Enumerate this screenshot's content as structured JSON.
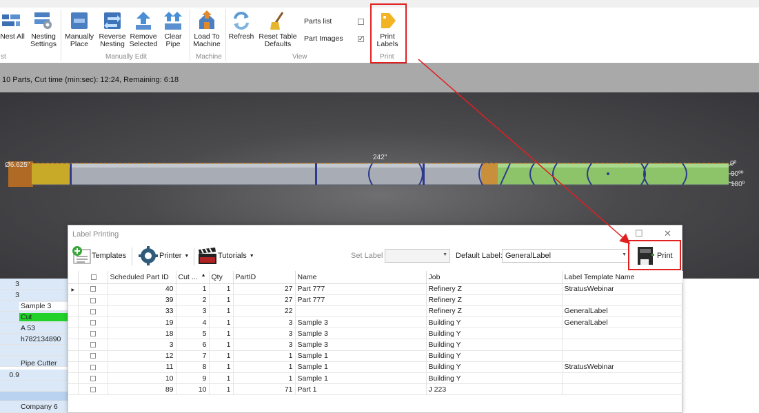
{
  "ribbon": {
    "buttons": [
      {
        "label": "Nest All",
        "icon": "nest-all-icon"
      },
      {
        "label": "Nesting\nSettings",
        "icon": "nesting-settings-icon"
      },
      {
        "label": "Manually\nPlace",
        "icon": "manually-place-icon"
      },
      {
        "label": "Reverse\nNesting",
        "icon": "reverse-nesting-icon"
      },
      {
        "label": "Remove\nSelected",
        "icon": "remove-selected-icon"
      },
      {
        "label": "Clear\nPipe",
        "icon": "clear-pipe-icon"
      },
      {
        "label": "Load To\nMachine",
        "icon": "load-to-machine-icon"
      },
      {
        "label": "Refresh",
        "icon": "refresh-icon"
      },
      {
        "label": "Reset Table\nDefaults",
        "icon": "reset-table-icon"
      },
      {
        "label": "Print\nLabels",
        "icon": "print-labels-icon"
      }
    ],
    "groups": {
      "nest": "st",
      "manual_edit": "Manually Edit",
      "machine": "Machine",
      "view": "View",
      "print": "Print"
    },
    "view_checks": [
      {
        "label": "Parts list",
        "checked": false
      },
      {
        "label": "Part Images",
        "checked": true
      }
    ]
  },
  "status": {
    "text": "10 Parts,   Cut time (min:sec): 12:24, Remaining: 6:18"
  },
  "viewport": {
    "diameter": "Ø6.625\"",
    "length": "242\"",
    "angle_0": "0º",
    "angle_90": "90ºº",
    "angle_180": "180º"
  },
  "left_grid": {
    "rows": [
      {
        "num": "3",
        "text": ""
      },
      {
        "num": "3",
        "text": ""
      },
      {
        "num": "",
        "text": "Sample 3"
      },
      {
        "num": "",
        "text": "Cut"
      },
      {
        "num": "",
        "text": "A 53"
      },
      {
        "num": "",
        "text": "h782134890"
      },
      {
        "num": "",
        "text": ""
      },
      {
        "num": "",
        "text": "Pipe Cutter"
      },
      {
        "num": "0.9",
        "text": ""
      },
      {
        "num": "",
        "text": ""
      },
      {
        "num": "",
        "text": ""
      },
      {
        "num": "",
        "text": "Company 6"
      }
    ]
  },
  "dialog": {
    "title": "Label Printing",
    "toolbar": {
      "templates": "Templates",
      "printer": "Printer",
      "tutorials": "Tutorials",
      "set_label": "Set Label",
      "set_label_value": "",
      "default_label": "Default Label:",
      "default_label_value": "GeneralLabel",
      "print": "Print"
    },
    "columns": [
      "",
      "",
      "Scheduled Part ID",
      "Cut ...",
      "Qty",
      "PartID",
      "Name",
      "Job",
      "Label Template Name"
    ],
    "rows": [
      {
        "spid": "40",
        "cut": "1",
        "qty": "1",
        "partid": "27",
        "name": "Part 777",
        "job": "Refinery Z",
        "template": "StratusWebinar"
      },
      {
        "spid": "39",
        "cut": "2",
        "qty": "1",
        "partid": "27",
        "name": "Part 777",
        "job": "Refinery Z",
        "template": ""
      },
      {
        "spid": "33",
        "cut": "3",
        "qty": "1",
        "partid": "22",
        "name": "",
        "job": "Refinery Z",
        "template": "GeneralLabel"
      },
      {
        "spid": "19",
        "cut": "4",
        "qty": "1",
        "partid": "3",
        "name": "Sample 3",
        "job": "Building Y",
        "template": "GeneralLabel"
      },
      {
        "spid": "18",
        "cut": "5",
        "qty": "1",
        "partid": "3",
        "name": "Sample 3",
        "job": "Building Y",
        "template": ""
      },
      {
        "spid": "3",
        "cut": "6",
        "qty": "1",
        "partid": "3",
        "name": "Sample 3",
        "job": "Building Y",
        "template": ""
      },
      {
        "spid": "12",
        "cut": "7",
        "qty": "1",
        "partid": "1",
        "name": "Sample 1",
        "job": "Building Y",
        "template": ""
      },
      {
        "spid": "11",
        "cut": "8",
        "qty": "1",
        "partid": "1",
        "name": "Sample 1",
        "job": "Building Y",
        "template": "StratusWebinar"
      },
      {
        "spid": "10",
        "cut": "9",
        "qty": "1",
        "partid": "1",
        "name": "Sample 1",
        "job": "Building Y",
        "template": ""
      },
      {
        "spid": "89",
        "cut": "10",
        "qty": "1",
        "partid": "71",
        "name": "Part 1",
        "job": "J 223",
        "template": ""
      }
    ]
  },
  "colors": {
    "highlight_red": "#e11f1f",
    "left_grid_blue": "#dbe8f7",
    "cut_green": "#22d12a",
    "pipe_green": "#8dc46a",
    "pipe_gray": "#a8acb4"
  }
}
